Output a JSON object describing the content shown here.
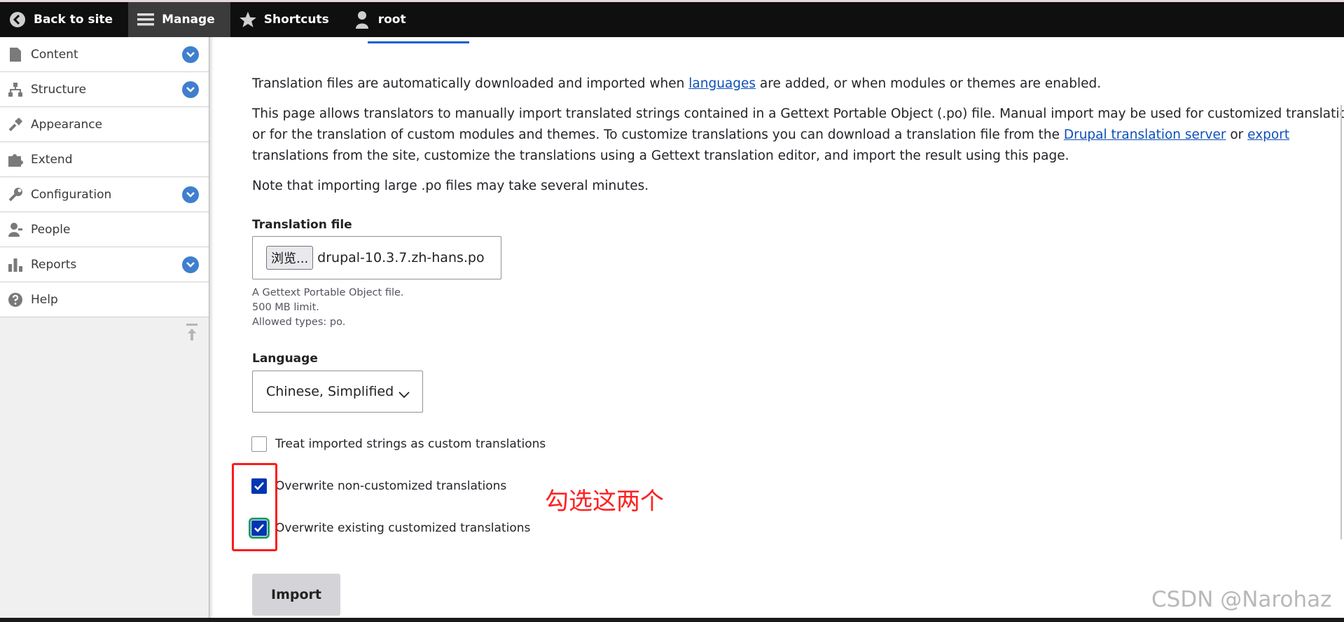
{
  "toolbar": {
    "back": "Back to site",
    "manage": "Manage",
    "shortcuts": "Shortcuts",
    "user": "root"
  },
  "sidebar": {
    "items": [
      {
        "label": "Content",
        "icon": "file-icon",
        "expandable": true
      },
      {
        "label": "Structure",
        "icon": "sitemap-icon",
        "expandable": true
      },
      {
        "label": "Appearance",
        "icon": "paintbrush-icon",
        "expandable": false
      },
      {
        "label": "Extend",
        "icon": "puzzle-icon",
        "expandable": false
      },
      {
        "label": "Configuration",
        "icon": "wrench-icon",
        "expandable": true
      },
      {
        "label": "People",
        "icon": "people-icon",
        "expandable": false
      },
      {
        "label": "Reports",
        "icon": "bar-chart-icon",
        "expandable": true
      },
      {
        "label": "Help",
        "icon": "help-icon",
        "expandable": false
      }
    ]
  },
  "intro": {
    "p1_before": "Translation files are automatically downloaded and imported when ",
    "p1_link": "languages",
    "p1_after": " are added, or when modules or themes are enabled.",
    "p2_line1": "This page allows translators to manually import translated strings contained in a Gettext Portable Object (.po) file. Manual import may be used for customized translations",
    "p2_line2_before": "or for the translation of custom modules and themes. To customize translations you can download a translation file from the ",
    "p2_link1": "Drupal translation server",
    "p2_mid": " or ",
    "p2_link2": "export",
    "p2_line3": "translations from the site, customize the translations using a Gettext translation editor, and import the result using this page.",
    "p3": "Note that importing large .po files may take several minutes."
  },
  "file": {
    "label": "Translation file",
    "browse": "浏览...",
    "filename": "drupal-10.3.7.zh-hans.po",
    "desc1": "A Gettext Portable Object file.",
    "desc2": "500 MB limit.",
    "desc3": "Allowed types: po."
  },
  "language": {
    "label": "Language",
    "selected": "Chinese, Simplified"
  },
  "options": {
    "custom": {
      "label": "Treat imported strings as custom translations",
      "checked": false
    },
    "overwrite_noncustom": {
      "label": "Overwrite non-customized translations",
      "checked": true
    },
    "overwrite_custom": {
      "label": "Overwrite existing customized translations",
      "checked": true
    }
  },
  "import_label": "Import",
  "annotation": "勾选这两个",
  "watermark": "CSDN @Narohaz",
  "colors": {
    "accent": "#0036b1",
    "link": "#0f4fb8",
    "annotation": "#ff2020",
    "chevron": "#3f7fce"
  }
}
